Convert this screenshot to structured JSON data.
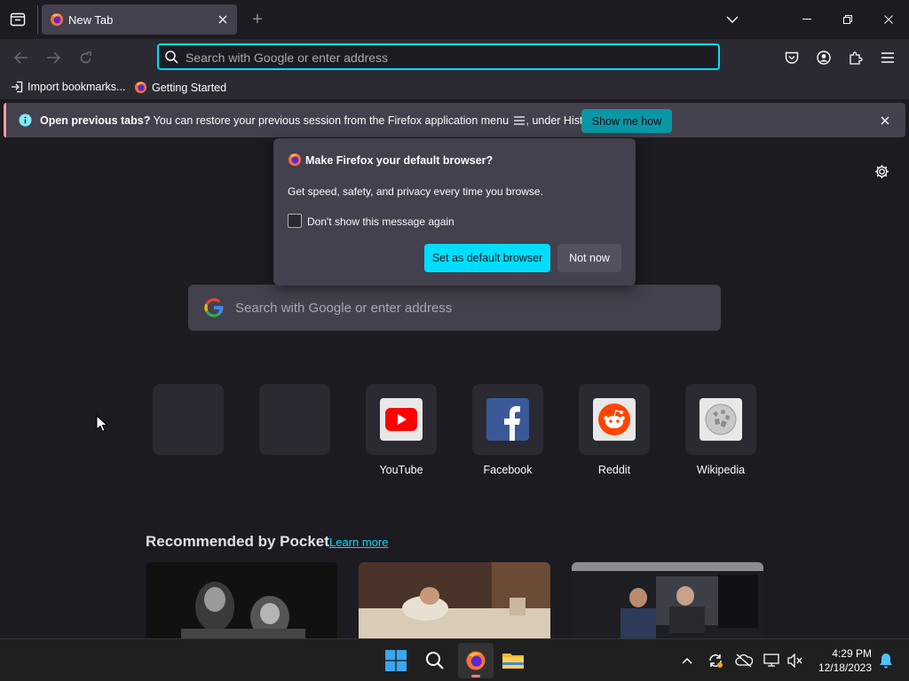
{
  "tab": {
    "title": "New Tab",
    "new_tab_symbol": "+"
  },
  "urlbar": {
    "placeholder": "Search with Google or enter address"
  },
  "bookmarks": [
    {
      "label": "Import bookmarks..."
    },
    {
      "label": "Getting Started"
    }
  ],
  "notification": {
    "bold": "Open previous tabs?",
    "message": " You can restore your previous session from the Firefox application menu",
    "suffix": ", under History.",
    "button": "Show me how"
  },
  "popup": {
    "title": "Make Firefox your default browser?",
    "body": "Get speed, safety, and privacy every time you browse.",
    "checkbox_label": "Don't show this message again",
    "primary_button": "Set as default browser",
    "secondary_button": "Not now"
  },
  "content": {
    "search_placeholder": "Search with Google or enter address",
    "top_sites": [
      {
        "label": ""
      },
      {
        "label": ""
      },
      {
        "label": "YouTube"
      },
      {
        "label": "Facebook"
      },
      {
        "label": "Reddit"
      },
      {
        "label": "Wikipedia"
      }
    ],
    "pocket": {
      "title": "Recommended by Pocket",
      "learn_more": "Learn more"
    }
  },
  "taskbar": {
    "time": "4:29 PM",
    "date": "12/18/2023"
  },
  "colors": {
    "accent": "#00ddff",
    "toolbar": "#2b2a33",
    "background": "#1c1b22",
    "panel": "#42414d"
  }
}
